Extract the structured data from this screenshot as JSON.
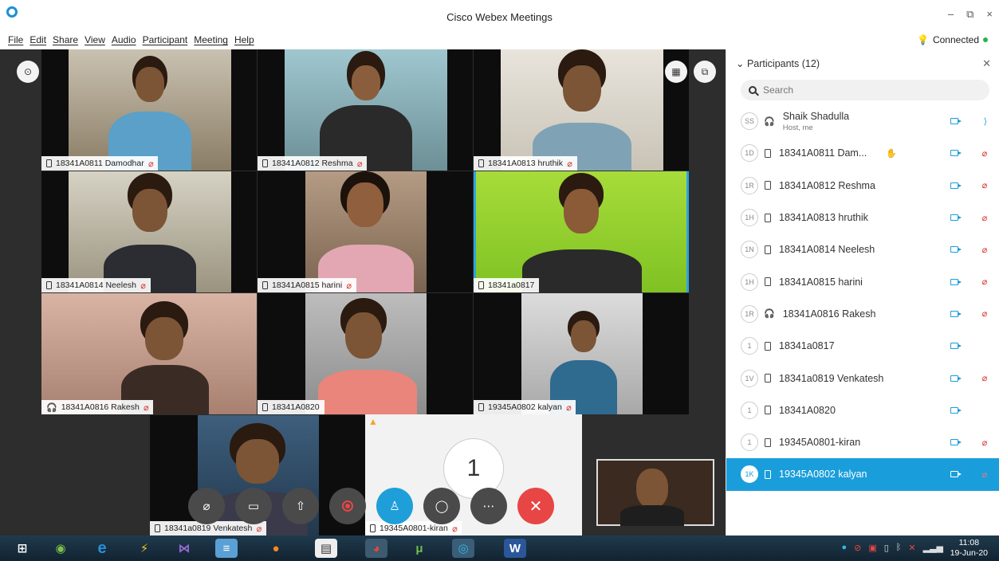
{
  "window": {
    "title": "Cisco Webex Meetings",
    "minimize": "–",
    "restore": "⧉",
    "close": "×"
  },
  "menu": [
    "File",
    "Edit",
    "Share",
    "View",
    "Audio",
    "Participant",
    "Meeting",
    "Help"
  ],
  "status": {
    "connection": "Connected",
    "dot_color": "#2bb24c"
  },
  "video_tiles": [
    {
      "name": "18341A0811 Damodhar",
      "muted": true,
      "device": "phone"
    },
    {
      "name": "18341A0812 Reshma",
      "muted": true,
      "device": "phone"
    },
    {
      "name": "18341A0813 hruthik",
      "muted": true,
      "device": "phone"
    },
    {
      "name": "18341A0814 Neelesh",
      "muted": true,
      "device": "phone"
    },
    {
      "name": "18341A0815 harini",
      "muted": true,
      "device": "phone"
    },
    {
      "name": "18341a0817",
      "muted": false,
      "device": "phone",
      "active": true
    },
    {
      "name": "18341A0816 Rakesh",
      "muted": true,
      "device": "headset"
    },
    {
      "name": "18341A0820",
      "muted": false,
      "device": "phone"
    },
    {
      "name": "19345A0802 kalyan",
      "muted": true,
      "device": "phone"
    },
    {
      "name": "18341a0819 Venkatesh",
      "muted": true,
      "device": "phone"
    },
    {
      "name": "19345A0801-kiran",
      "muted": true,
      "device": "phone"
    }
  ],
  "overflow_count": "1",
  "controls": [
    "mute-mic",
    "stop-video",
    "share",
    "record",
    "participants",
    "chat",
    "more",
    "leave"
  ],
  "participants_panel": {
    "title": "Participants (12)",
    "search_placeholder": "Search",
    "list": [
      {
        "initials": "SS",
        "name": "Shaik  Shadulla",
        "sub": "Host, me",
        "device": "headset",
        "video": true,
        "mic": "on"
      },
      {
        "initials": "1D",
        "name": "18341A0811 Dam...",
        "device": "phone",
        "video": true,
        "mic": "muted",
        "hand": true
      },
      {
        "initials": "1R",
        "name": "18341A0812 Reshma",
        "device": "phone",
        "video": true,
        "mic": "muted"
      },
      {
        "initials": "1H",
        "name": "18341A0813 hruthik",
        "device": "phone",
        "video": true,
        "mic": "muted"
      },
      {
        "initials": "1N",
        "name": "18341A0814 Neelesh",
        "device": "phone",
        "video": true,
        "mic": "muted"
      },
      {
        "initials": "1H",
        "name": "18341A0815 harini",
        "device": "phone",
        "video": true,
        "mic": "muted"
      },
      {
        "initials": "1R",
        "name": "18341A0816 Rakesh",
        "device": "headset",
        "video": true,
        "mic": "muted"
      },
      {
        "initials": "1",
        "name": "18341a0817",
        "device": "phone",
        "video": true,
        "mic": "none"
      },
      {
        "initials": "1V",
        "name": "18341a0819 Venkatesh",
        "device": "phone",
        "video": true,
        "mic": "muted"
      },
      {
        "initials": "1",
        "name": "18341A0820",
        "device": "phone",
        "video": true,
        "mic": "none"
      },
      {
        "initials": "1",
        "name": "19345A0801-kiran",
        "device": "phone",
        "video": true,
        "mic": "muted"
      },
      {
        "initials": "1K",
        "name": "19345A0802 kalyan",
        "device": "phone",
        "video": true,
        "mic": "muted",
        "selected": true
      }
    ]
  },
  "taskbar": {
    "apps": [
      "windows-start",
      "network-globe",
      "internet-explorer",
      "winamp",
      "visual-studio",
      "notepad",
      "firefox",
      "calculator",
      "chrome",
      "utorrent",
      "webex",
      "word"
    ],
    "tray_icons": [
      "webex-tray",
      "cancel-tray",
      "acrobat-tray",
      "tablet-tray",
      "bluetooth-tray",
      "network-off-tray",
      "signal-tray"
    ],
    "time": "11:08",
    "date": "19-Jun-20"
  }
}
